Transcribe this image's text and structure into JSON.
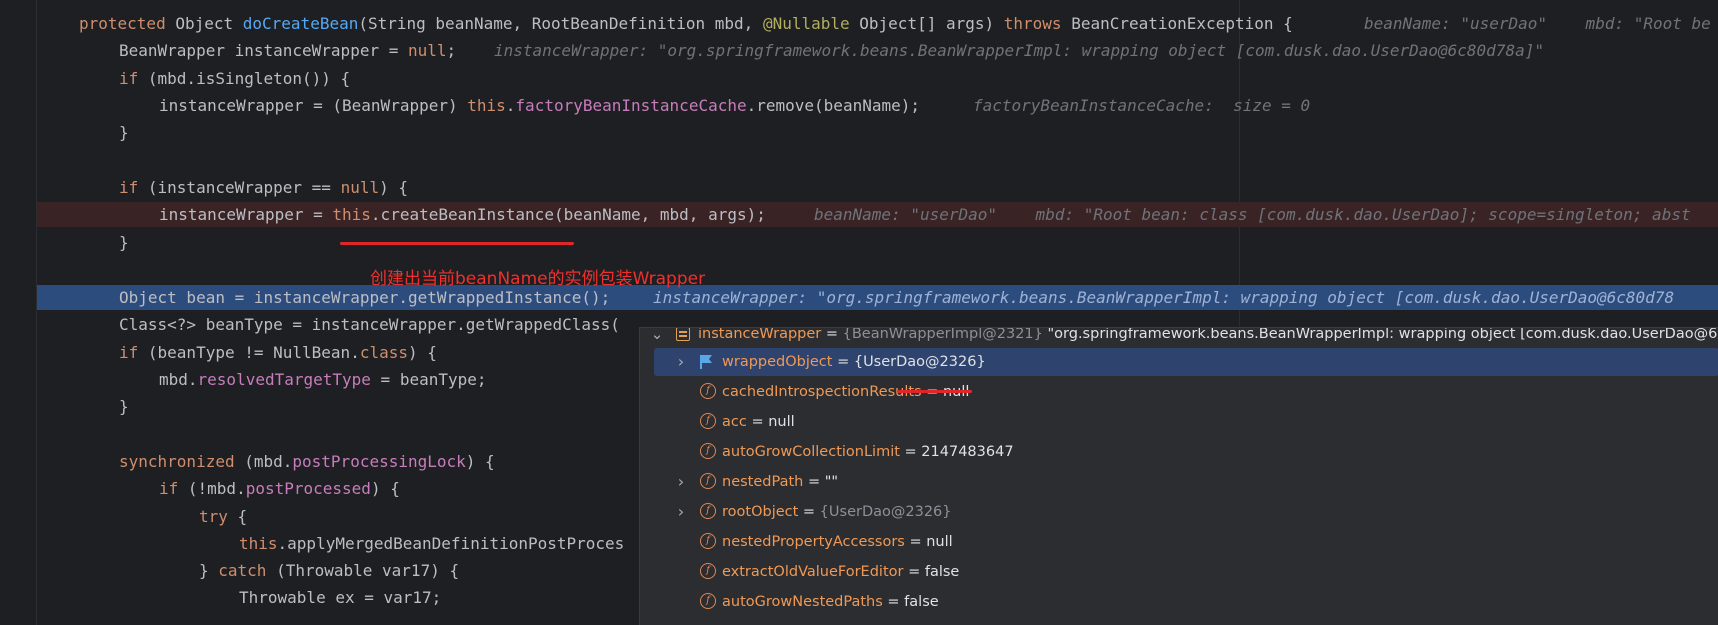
{
  "editor": {
    "lines": [
      {
        "id": "l1",
        "code": [
          [
            "kw",
            "protected "
          ],
          [
            "",
            "Object "
          ],
          [
            "fn",
            "doCreateBean"
          ],
          [
            "",
            "(String beanName, RootBeanDefinition mbd, "
          ],
          [
            "ann",
            "@Nullable"
          ],
          [
            "",
            ""
          ],
          [
            "",
            " Object[] args) "
          ],
          [
            "kw",
            "throws"
          ],
          [
            "",
            " BeanCreationException {"
          ]
        ],
        "hint": "beanName: \"userDao\"    mbd: \"Root be"
      },
      {
        "id": "l2",
        "code": [
          [
            "",
            "BeanWrapper instanceWrapper = "
          ],
          [
            "kw",
            "null"
          ],
          [
            "",
            ";"
          ]
        ],
        "hint": "instanceWrapper: \"org.springframework.beans.BeanWrapperImpl: wrapping object [com.dusk.dao.UserDao@6c80d78a]\""
      },
      {
        "id": "l3",
        "code": [
          [
            "kw",
            "if"
          ],
          [
            "",
            " (mbd.isSingleton()) {"
          ]
        ],
        "hint": ""
      },
      {
        "id": "l4",
        "code": [
          [
            "",
            "instanceWrapper = (BeanWrapper) "
          ],
          [
            "kw",
            "this"
          ],
          [
            "",
            "."
          ],
          [
            "field",
            "factoryBeanInstanceCache"
          ],
          [
            "",
            ".remove(beanName);"
          ]
        ],
        "hint": "factoryBeanInstanceCache:  size = 0"
      },
      {
        "id": "l5",
        "code": [
          [
            "",
            "}"
          ]
        ],
        "hint": ""
      },
      {
        "id": "l6",
        "code": [],
        "hint": ""
      },
      {
        "id": "l7",
        "code": [
          [
            "kw",
            "if"
          ],
          [
            "",
            " (instanceWrapper == "
          ],
          [
            "kw",
            "null"
          ],
          [
            "",
            ") {"
          ]
        ],
        "hint": ""
      },
      {
        "id": "l8",
        "code": [
          [
            "",
            "instanceWrapper = "
          ],
          [
            "kw",
            "this"
          ],
          [
            "",
            ".createBeanInstance(beanName, mbd, args);"
          ]
        ],
        "hint": "beanName: \"userDao\"    mbd: \"Root bean: class [com.dusk.dao.UserDao]; scope=singleton; abst"
      },
      {
        "id": "l9",
        "code": [
          [
            "",
            "}"
          ]
        ],
        "hint": ""
      },
      {
        "id": "l10",
        "code": [],
        "hint": ""
      },
      {
        "id": "l11",
        "code": [
          [
            "",
            "Object bean = instanceWrapper.getWrappedInstance();"
          ]
        ],
        "hint": "instanceWrapper: \"org.springframework.beans.BeanWrapperImpl: wrapping object [com.dusk.dao.UserDao@6c80d78"
      },
      {
        "id": "l12",
        "code": [
          [
            "",
            "Class<?> beanType = instanceWrapper.getWrappedClass("
          ]
        ],
        "hint": ""
      },
      {
        "id": "l13",
        "code": [
          [
            "kw",
            "if"
          ],
          [
            "",
            " (beanType != NullBean."
          ],
          [
            "kw",
            "class"
          ],
          [
            "",
            ") {"
          ]
        ],
        "hint": ""
      },
      {
        "id": "l14",
        "code": [
          [
            "",
            "mbd."
          ],
          [
            "field",
            "resolvedTargetType"
          ],
          [
            "",
            " = beanType;"
          ]
        ],
        "hint": ""
      },
      {
        "id": "l15",
        "code": [
          [
            "",
            "}"
          ]
        ],
        "hint": ""
      },
      {
        "id": "l16",
        "code": [],
        "hint": ""
      },
      {
        "id": "l17",
        "code": [
          [
            "kw",
            "synchronized"
          ],
          [
            "",
            " (mbd."
          ],
          [
            "field",
            "postProcessingLock"
          ],
          [
            "",
            ") {"
          ]
        ],
        "hint": ""
      },
      {
        "id": "l18",
        "code": [
          [
            "kw",
            "if"
          ],
          [
            "",
            " (!mbd."
          ],
          [
            "field",
            "postProcessed"
          ],
          [
            "",
            ") {"
          ]
        ],
        "hint": ""
      },
      {
        "id": "l19",
        "code": [
          [
            "kw",
            "try"
          ],
          [
            "",
            " {"
          ]
        ],
        "hint": ""
      },
      {
        "id": "l20",
        "code": [
          [
            "kw",
            "this"
          ],
          [
            "",
            ".applyMergedBeanDefinitionPostProces"
          ]
        ],
        "hint": ""
      },
      {
        "id": "l21",
        "code": [
          [
            "",
            "} "
          ],
          [
            "kw",
            "catch"
          ],
          [
            "",
            " (Throwable var17) {"
          ]
        ],
        "hint": ""
      },
      {
        "id": "l22",
        "code": [
          [
            "",
            "Throwable ex = var17;"
          ]
        ],
        "hint": ""
      }
    ]
  },
  "annotation_note": "创建出当前beanName的实例包装Wrapper",
  "debugger": {
    "rows": [
      {
        "name": "instanceWrapper",
        "type": "{BeanWrapperImpl@2321}",
        "value": " \"org.springframework.beans.BeanWrapperImpl: wrapping object [com.dusk.dao.UserDao@6c",
        "icon": "stack-icon",
        "chevron": "expanded"
      },
      {
        "name": "wrappedObject",
        "type": "",
        "value": "{UserDao@2326}",
        "icon": "flag-icon",
        "chevron": "collapsed"
      },
      {
        "name": "cachedIntrospectionResults",
        "type": "",
        "value": "null",
        "icon": "field-icon",
        "chevron": ""
      },
      {
        "name": "acc",
        "type": "",
        "value": "null",
        "icon": "field-icon",
        "chevron": ""
      },
      {
        "name": "autoGrowCollectionLimit",
        "type": "",
        "value": "2147483647",
        "icon": "field-icon",
        "chevron": ""
      },
      {
        "name": "nestedPath",
        "type": "",
        "value": "\"\"",
        "icon": "field-icon",
        "chevron": "collapsed"
      },
      {
        "name": "rootObject",
        "type": "{UserDao@2326}",
        "value": "",
        "icon": "field-icon",
        "chevron": "collapsed"
      },
      {
        "name": "nestedPropertyAccessors",
        "type": "",
        "value": "null",
        "icon": "field-icon",
        "chevron": ""
      },
      {
        "name": "extractOldValueForEditor",
        "type": "",
        "value": "false",
        "icon": "field-icon",
        "chevron": ""
      },
      {
        "name": "autoGrowNestedPaths",
        "type": "",
        "value": "false",
        "icon": "field-icon",
        "chevron": ""
      }
    ],
    "equals": " = ",
    "field_letter": "f"
  },
  "colors": {
    "breakpoint_line": "#3a2325",
    "current_line": "#2d4c7e",
    "annotation_red": "#f0302e",
    "field_name": "#f09955"
  }
}
